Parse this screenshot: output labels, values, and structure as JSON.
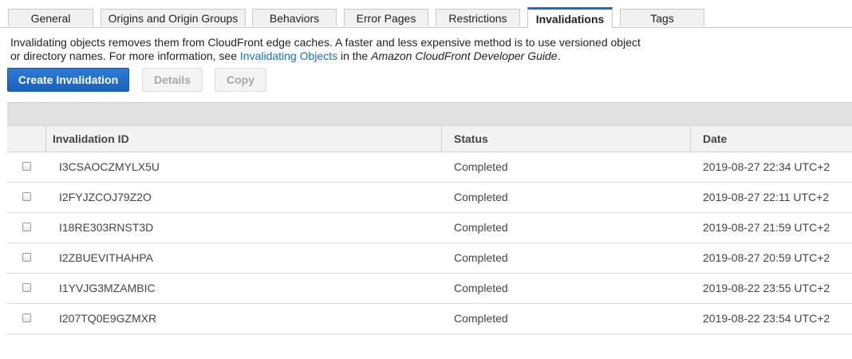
{
  "tabs": [
    {
      "label": "General",
      "active": false
    },
    {
      "label": "Origins and Origin Groups",
      "active": false
    },
    {
      "label": "Behaviors",
      "active": false
    },
    {
      "label": "Error Pages",
      "active": false
    },
    {
      "label": "Restrictions",
      "active": false
    },
    {
      "label": "Invalidations",
      "active": true
    },
    {
      "label": "Tags",
      "active": false
    }
  ],
  "description": {
    "line1": "Invalidating objects removes them from CloudFront edge caches. A faster and less expensive method is to use versioned object",
    "line2_prefix": "or directory names. For more information, see ",
    "link": "Invalidating Objects",
    "middle": " in the ",
    "guide": "Amazon CloudFront Developer Guide",
    "suffix": "."
  },
  "toolbar": {
    "create_label": "Create Invalidation",
    "details_label": "Details",
    "copy_label": "Copy"
  },
  "table": {
    "columns": [
      "Invalidation ID",
      "Status",
      "Date"
    ],
    "rows": [
      {
        "id": "I3CSAOCZMYLX5U",
        "status": "Completed",
        "date": "2019-08-27 22:34 UTC+2"
      },
      {
        "id": "I2FYJZCOJ79Z2O",
        "status": "Completed",
        "date": "2019-08-27 22:11 UTC+2"
      },
      {
        "id": "I18RE303RNST3D",
        "status": "Completed",
        "date": "2019-08-27 21:59 UTC+2"
      },
      {
        "id": "I2ZBUEVITHAHPA",
        "status": "Completed",
        "date": "2019-08-27 20:59 UTC+2"
      },
      {
        "id": "I1YVJG3MZAMBIC",
        "status": "Completed",
        "date": "2019-08-22 23:55 UTC+2"
      },
      {
        "id": "I207TQ0E9GZMXR",
        "status": "Completed",
        "date": "2019-08-22 23:54 UTC+2"
      }
    ]
  },
  "colors": {
    "accent": "#1f6fcc",
    "link": "#1a6ec9",
    "active_tab_border": "#1f6fbf"
  }
}
